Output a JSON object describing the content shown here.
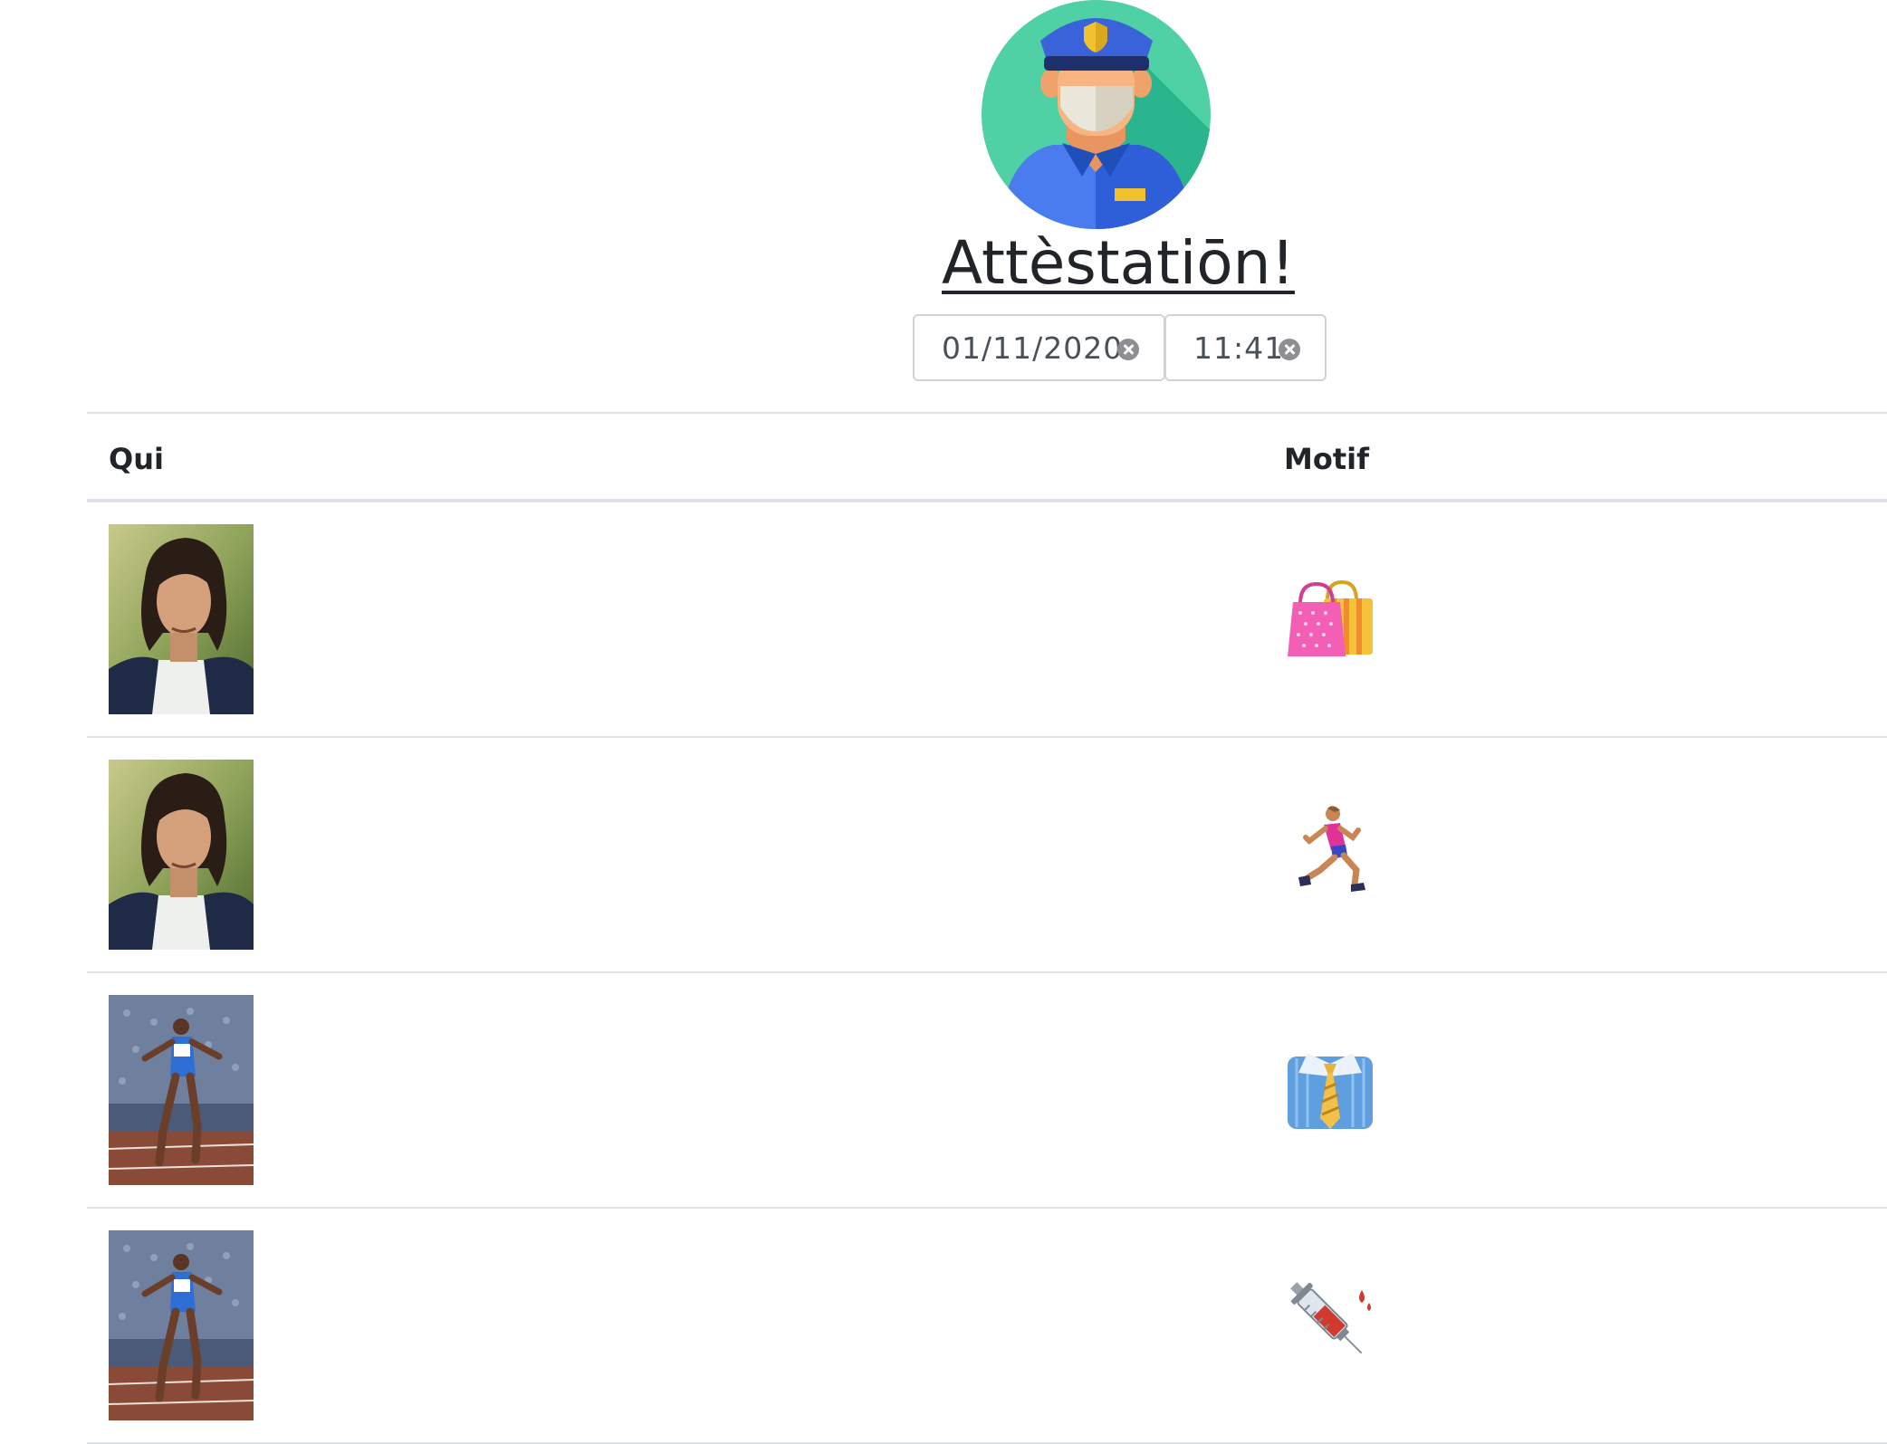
{
  "header": {
    "logo_icon": "police-officer-with-mask-icon",
    "title": "Attèstatiōn!"
  },
  "date_field": {
    "value": "01/11/2020"
  },
  "time_field": {
    "value": "11:41"
  },
  "table": {
    "columns": [
      "Qui",
      "Motif"
    ],
    "rows": [
      {
        "person_photo": "man-portrait-photo",
        "motif_icon": "shopping-bags-icon"
      },
      {
        "person_photo": "man-portrait-photo",
        "motif_icon": "runner-icon"
      },
      {
        "person_photo": "sprinter-photo",
        "motif_icon": "shirt-and-tie-icon"
      },
      {
        "person_photo": "sprinter-photo",
        "motif_icon": "syringe-icon"
      }
    ]
  }
}
